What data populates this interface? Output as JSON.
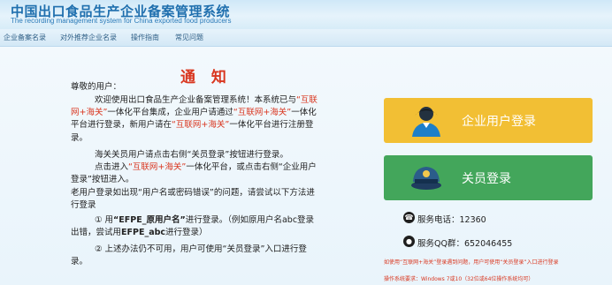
{
  "header": {
    "title": "中国出口食品生产企业备案管理系统",
    "subtitle": "The recording management system for China exported food producers"
  },
  "nav": {
    "items": [
      "企业备案名录",
      "对外推荐企业名录",
      "操作指南",
      "常见问题"
    ]
  },
  "notice": {
    "title": "通 知",
    "greeting": "尊敬的用户：",
    "p1": {
      "a": "欢迎使用出口食品生产企业备案管理系统！本系统已与",
      "b": "“互联网+海关”",
      "c": "一体化平台集成，企业用户请通过",
      "d": "“互联网+海关”",
      "e": "一体化平台进行登录，新用户请在",
      "f": "“互联网+海关”",
      "g": "一体化平台进行注册登录。"
    },
    "p2": "海关关员用户请点击右侧“关员登录”按钮进行登录。",
    "p3": {
      "a": "点击进入",
      "b": "“互联网+海关”",
      "c": "一体化平台，或点击右侧“企业用户登录”按钮进入。"
    },
    "p4": "老用户登录如出现“用户名或密码错误”的问题，请尝试以下方法进行登录",
    "p5": {
      "a": "① 用",
      "b": "“EFPE_原用户名”",
      "c": "进行登录。（例如原用户名abc登录出错，尝试用",
      "d": "EFPE_abc",
      "e": "进行登录）"
    },
    "p6": "② 上述办法仍不可用，用户可使用“关员登录”入口进行登录。"
  },
  "buttons": {
    "enterprise": "企业用户登录",
    "customs": "关员登录"
  },
  "service": {
    "phone": "服务电话：12360",
    "qq": "服务QQ群：652046455"
  },
  "footnotes": {
    "line1": "如使用“互联网+海关”登录遇到问题，用户可使用“关员登录”入口进行登录",
    "line2": "操作系统要求：Windows 7或10（32位或64位操作系统均可）"
  },
  "colors": {
    "accent_red": "#d9361f",
    "enterprise_button": "#f2bf34",
    "customs_button": "#43a65b",
    "header_blue": "#1f6fae"
  },
  "icons": {
    "enterprise": "user-avatar-icon",
    "customs": "customs-officer-cap-icon",
    "phone": "phone-icon",
    "qq": "qq-penguin-icon"
  }
}
